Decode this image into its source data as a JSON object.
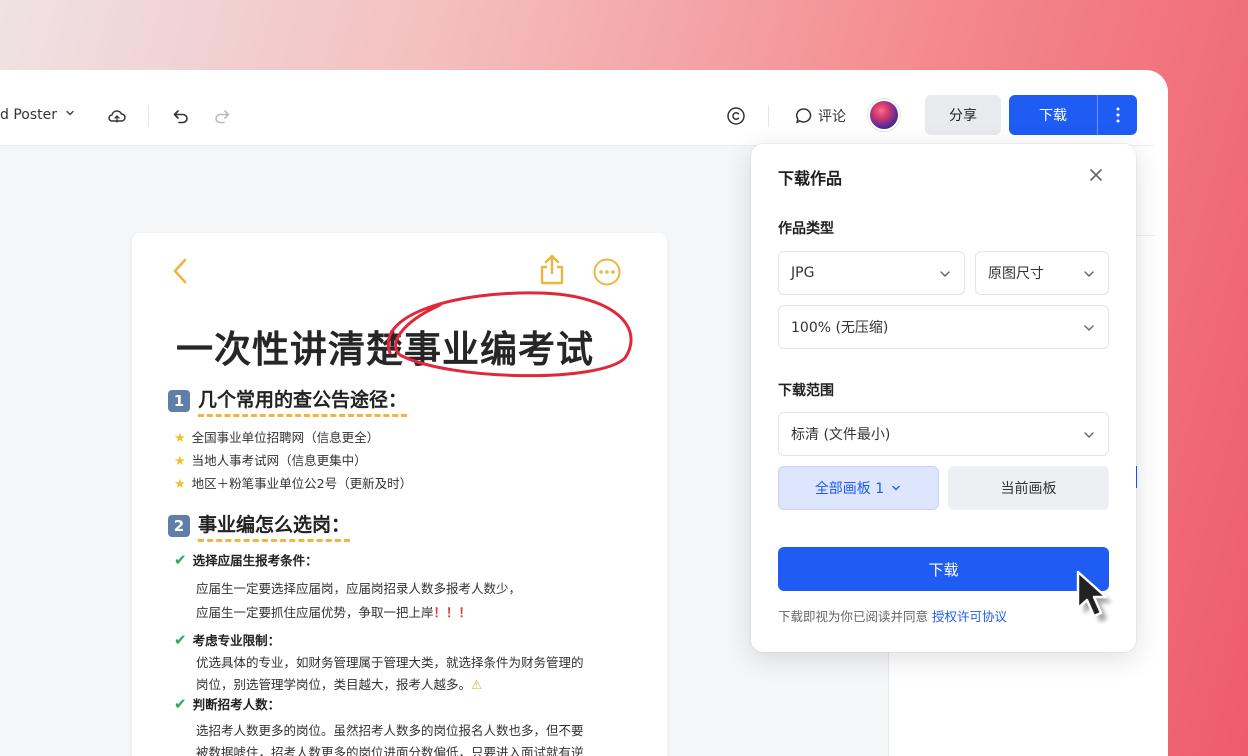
{
  "toolbar": {
    "doc_name": "d Poster",
    "comment_label": "评论",
    "share_label": "分享",
    "download_label": "下载"
  },
  "poster": {
    "title": "一次性讲清楚事业编考试",
    "section1": {
      "num": "1",
      "heading": "几个常用的查公告途径："
    },
    "section1_items": [
      "全国事业单位招聘网（信息更全）",
      "当地人事考试网（信息更集中）",
      "地区＋粉笔事业单位公2号（更新及时）"
    ],
    "section2": {
      "num": "2",
      "heading": "事业编怎么选岗："
    },
    "sub1": "选择应届生报考条件：",
    "sub1_lines": [
      "应届生一定要选择应届岗，应届岗招录人数多报考人数少，",
      "应届生一定要抓住应届优势，争取一把上岸"
    ],
    "exclaim": "！！！",
    "sub2": "考虑专业限制：",
    "sub2_lines": [
      "优选具体的专业，如财务管理属于管理大类，就选择条件为财务管理的",
      "岗位，别选管理学岗位，类目越大，报考人越多。"
    ],
    "sub3": "判断招考人数：",
    "sub3_lines": [
      "选招考人数更多的岗位。虽然招考人数多的岗位报名人数也多，但不要",
      "被数据唬住，招考人数更多的岗位进面分数偏低，只要进入面试就有逆"
    ]
  },
  "dialog": {
    "title": "下载作品",
    "type_label": "作品类型",
    "format_value": "JPG",
    "size_value": "原图尺寸",
    "quality_value": "100% (无压缩)",
    "range_label": "下载范围",
    "resolution_value": "标清 (文件最小)",
    "all_boards_label": "全部画板 1",
    "current_board_label": "当前画板",
    "download_button": "下载",
    "notice_text": "下载即视为你已阅读并同意",
    "notice_link": "授权许可协议"
  },
  "icons": {
    "cloud": "cloud-sync-icon",
    "undo": "undo-icon",
    "redo": "redo-icon",
    "copyright": "copyright-icon",
    "comment": "comment-icon",
    "more": "more-vertical-icon",
    "close": "close-icon"
  },
  "colors": {
    "primary": "#1e5cf3",
    "active_bg": "#dde6fd"
  }
}
